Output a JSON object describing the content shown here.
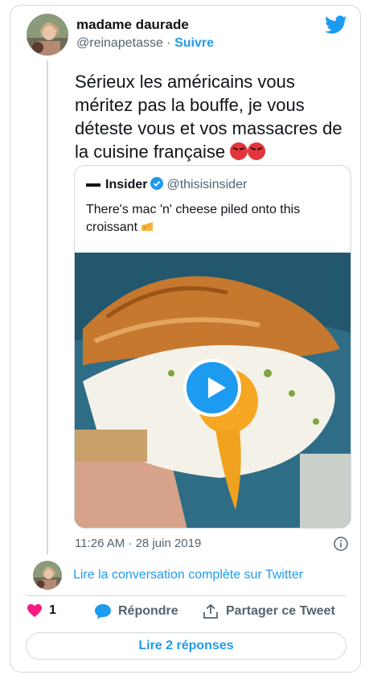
{
  "tweet": {
    "author_name": "madame daurade",
    "author_handle": "@reinapetasse",
    "separator": " · ",
    "follow_label": "Suivre",
    "text": "Sérieux les américains vous méritez pas la bouffe, je vous déteste vous et vos massacres de la cuisine française",
    "emojis": [
      "angry-face-icon",
      "angry-face-icon"
    ],
    "timestamp": "11:26 AM · 28 juin 2019"
  },
  "quoted": {
    "name": "Insider",
    "handle": "@thisisinsider",
    "text": "There's mac 'n' cheese piled onto this croissant",
    "media": "video",
    "play_icon": "play-icon"
  },
  "thread": {
    "read_conversation": "Lire la conversation complète sur Twitter"
  },
  "actions": {
    "like_count": "1",
    "reply_label": "Répondre",
    "share_label": "Partager ce Tweet"
  },
  "footer": {
    "replies_button": "Lire 2 réponses"
  },
  "colors": {
    "accent": "#1d9bf0",
    "like": "#f91880",
    "text": "#0f1419",
    "muted": "#536471",
    "border": "#cfd9de"
  }
}
